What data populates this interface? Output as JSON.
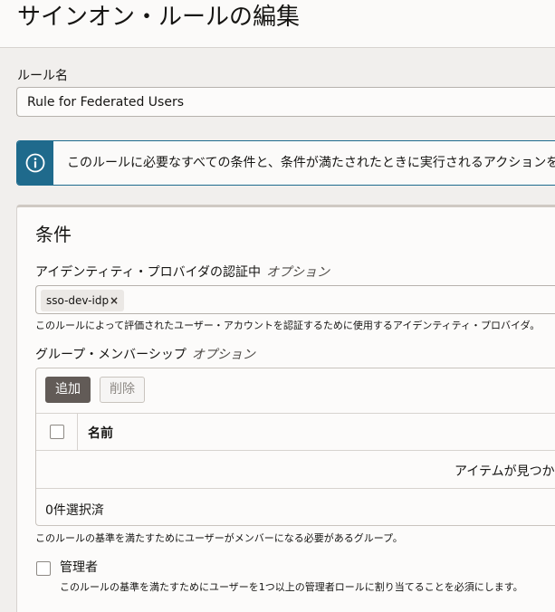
{
  "header": {
    "title": "サインオン・ルールの編集"
  },
  "rule_name": {
    "label": "ルール名",
    "value": "Rule for Federated Users"
  },
  "info": {
    "icon": "info-icon",
    "text": "このルールに必要なすべての条件と、条件が満たされたときに実行されるアクションを"
  },
  "conditions": {
    "title": "条件",
    "idp": {
      "label": "アイデンティティ・プロバイダの認証中",
      "optional": "オプション",
      "chips": [
        "sso-dev-idp"
      ],
      "remove_symbol": "×",
      "help": "このルールによって評価されたユーザー・アカウントを認証するために使用するアイデンティティ・プロバイダ。"
    },
    "groups": {
      "label": "グループ・メンバーシップ",
      "optional": "オプション",
      "add_label": "追加",
      "delete_label": "削除",
      "column_name": "名前",
      "empty_text": "アイテムが見つか",
      "selected_count": "0件選択済",
      "help": "このルールの基準を満たすためにユーザーがメンバーになる必要があるグループ。"
    },
    "admin": {
      "label": "管理者",
      "checked": false,
      "help": "このルールの基準を満たすためにユーザーを1つ以上の管理者ロールに割り当てることを必須にします。"
    }
  },
  "colors": {
    "info_accent": "#1f6a8c",
    "primary_button": "#625b57",
    "background": "#f1efed"
  }
}
